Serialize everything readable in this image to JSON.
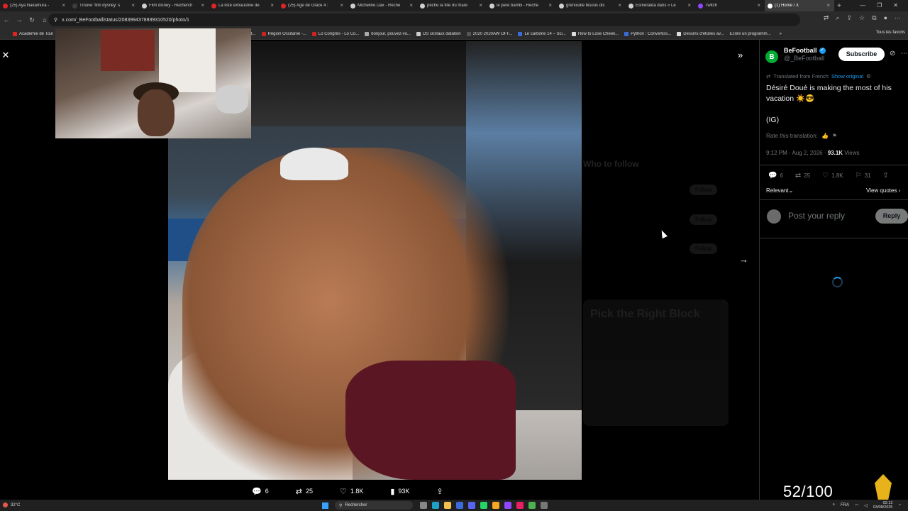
{
  "browser": {
    "tabs": [
      {
        "title": "(25) Aya Nakamura -",
        "color": "#e02424"
      },
      {
        "title": "Trouve 'film dysney' s",
        "color": "#3d3d3d"
      },
      {
        "title": "Film disney - Recherch",
        "color": "#cfcfcf"
      },
      {
        "title": "La liste exhaustive de",
        "color": "#e02424"
      },
      {
        "title": "(25) Age de Glace 4 :",
        "color": "#e02424"
      },
      {
        "title": "Micheline Dax - Reche",
        "color": "#cfcfcf"
      },
      {
        "title": "pêche la fille du mare",
        "color": "#cfcfcf"
      },
      {
        "title": "le pere bambi - Reche",
        "color": "#cfcfcf"
      },
      {
        "title": "grenouille bisous dis",
        "color": "#cfcfcf"
      },
      {
        "title": "Esmeralda dans « Le",
        "color": "#cfcfcf"
      },
      {
        "title": "Twitch",
        "color": "#9146ff"
      },
      {
        "title": "(1) Home / X",
        "color": "#ffffff",
        "active": true
      }
    ],
    "url": "x.com/_BeFootball/status/2083994378939310520/photo/1",
    "bookmarks": [
      {
        "label": "Académie de Toul",
        "color": "#e02424"
      },
      {
        "label": "- Tout...",
        "color": "#888888"
      },
      {
        "label": "Région Occitanie -...",
        "color": "#c22"
      },
      {
        "label": "Lo Congrès - Lo Co...",
        "color": "#c22"
      },
      {
        "label": "bonjour, pouvez-vo...",
        "color": "#aaaaaa"
      },
      {
        "label": "DS cristaux datation",
        "color": "#cccccc"
      },
      {
        "label": "2020 2020AW OFF...",
        "color": "#555555"
      },
      {
        "label": "Le carbone 14 – Sci...",
        "color": "#3a6bd8"
      },
      {
        "label": "How to Lose Cheek...",
        "color": "#dddddd"
      },
      {
        "label": "Python : Convertiss...",
        "color": "#3a6bd8"
      },
      {
        "label": "Dessins d'étoiles av...",
        "color": "#dddddd"
      },
      {
        "label": "Écrire un programm...",
        "color": "#dddddd"
      }
    ],
    "bookmarks_more": "»",
    "bookmarks_right": "Tous les favoris"
  },
  "viewer": {
    "close_icon": "✕",
    "collapse_icon": "»",
    "next_icon": "→",
    "actions": {
      "replies": "6",
      "reposts": "25",
      "likes": "1.8K",
      "views": "93K"
    },
    "dim_sidebar": {
      "who_to_follow": "Who to follow",
      "follow": "Follow",
      "ad_title": "Pick the Right Block"
    }
  },
  "tweet": {
    "author_name": "BeFootball",
    "author_handle": "@_BeFootball",
    "subscribe": "Subscribe",
    "translated_from": "Translated from French",
    "show_original": "Show original",
    "text": "Désiré Doué is making the most of his vacation ☀️😎",
    "text2": "(IG)",
    "rate_translation": "Rate this translation:",
    "time": "9:12 PM · Aug 2, 2026 · ",
    "views_count": "93.1K",
    "views_label": " Views",
    "stats": {
      "replies": "6",
      "reposts": "25",
      "likes": "1.8K",
      "bookmarks": "31"
    },
    "relevant": "Relevant",
    "view_quotes": "View quotes ›",
    "reply_placeholder": "Post your reply",
    "reply_button": "Reply"
  },
  "overlay": {
    "counter": "52/100"
  },
  "taskbar": {
    "temperature": "32°C",
    "search": "Rechercher",
    "lang": "FRA",
    "time": "02:12",
    "date": "03/08/2025"
  }
}
